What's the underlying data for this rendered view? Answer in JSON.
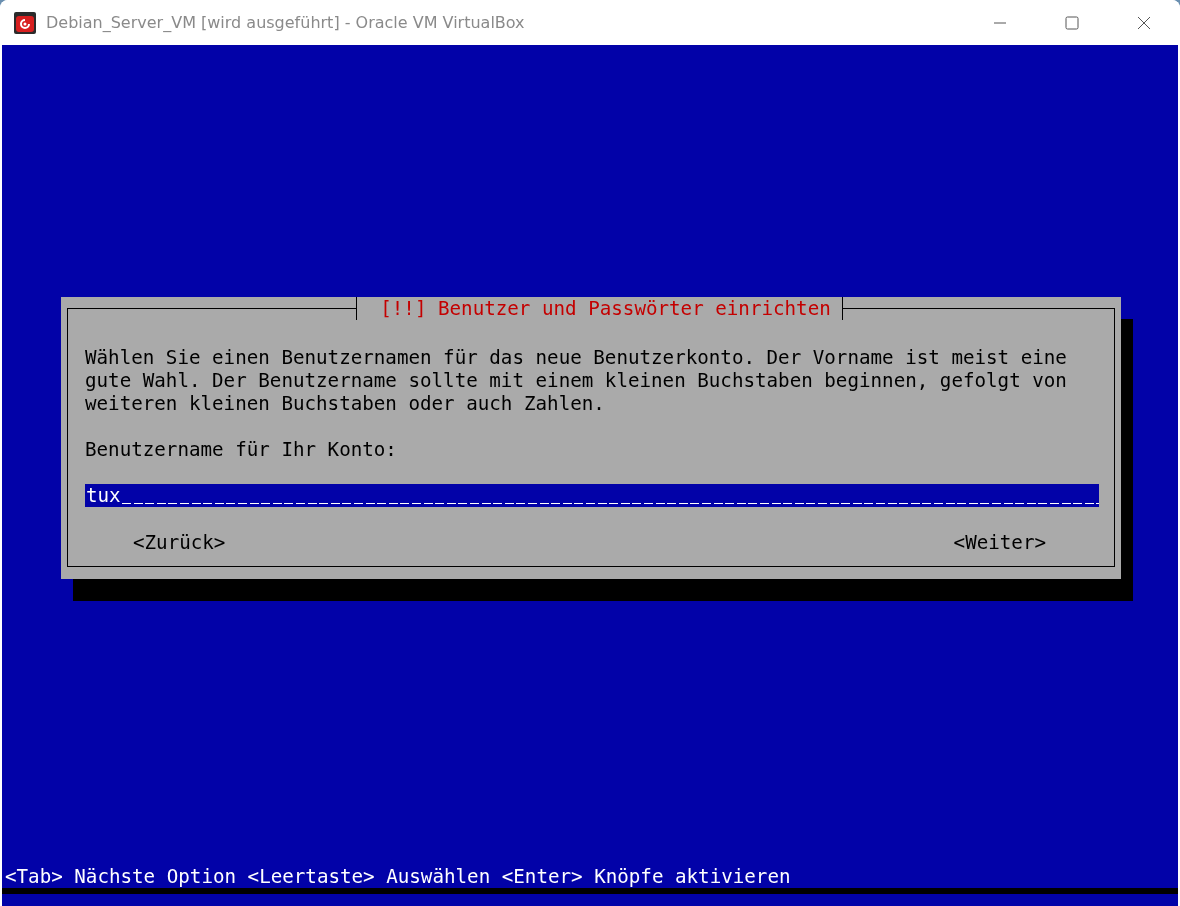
{
  "window": {
    "title": "Debian_Server_VM [wird ausgeführt] - Oracle VM VirtualBox"
  },
  "dialog": {
    "title": "[!!] Benutzer und Passwörter einrichten",
    "description": "Wählen Sie einen Benutzernamen für das neue Benutzerkonto. Der Vorname ist meist eine gute Wahl. Der Benutzername sollte mit einem kleinen Buchstaben beginnen, gefolgt von weiteren kleinen Buchstaben oder auch Zahlen.",
    "field_label": "Benutzername für Ihr Konto:",
    "field": {
      "value": "tux",
      "focused": true
    },
    "buttons": [
      {
        "label": "<Zurück>",
        "selected": false
      },
      {
        "label": "<Weiter>",
        "selected": false
      }
    ]
  },
  "status_bar": "<Tab> Nächste Option <Leertaste> Auswählen <Enter> Knöpfe aktivieren"
}
